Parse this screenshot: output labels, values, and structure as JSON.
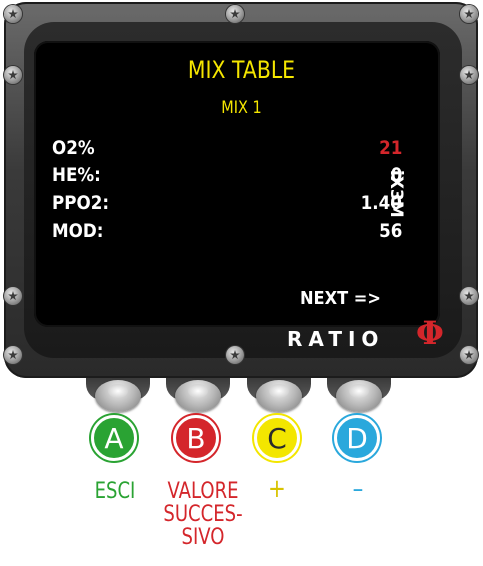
{
  "screen": {
    "title": "MIX TABLE",
    "subtitle": "MIX 1",
    "rows": [
      {
        "label": "O2%",
        "value": "21",
        "value_color": "#d4262b"
      },
      {
        "label": "HE%:",
        "value": "0"
      },
      {
        "label": "PPO2:",
        "value": "1.40"
      },
      {
        "label": "MOD:",
        "value": "56"
      }
    ],
    "next_label": "NEXT =>",
    "model": "iX3M",
    "brand": "RATIO",
    "brand_symbol": "Φ"
  },
  "buttons": [
    {
      "letter": "A",
      "action": "ESCI",
      "color": "#2aa333"
    },
    {
      "letter": "B",
      "action": "VALORE\nSUCCES-\nSIVO",
      "color": "#d4262b"
    },
    {
      "letter": "C",
      "action": "+",
      "color": "#f3e600"
    },
    {
      "letter": "D",
      "action": "–",
      "color": "#2aa8dc"
    }
  ],
  "colors": {
    "title": "#f5e600",
    "screen_bg": "#000000",
    "accent_red": "#d4262b"
  }
}
